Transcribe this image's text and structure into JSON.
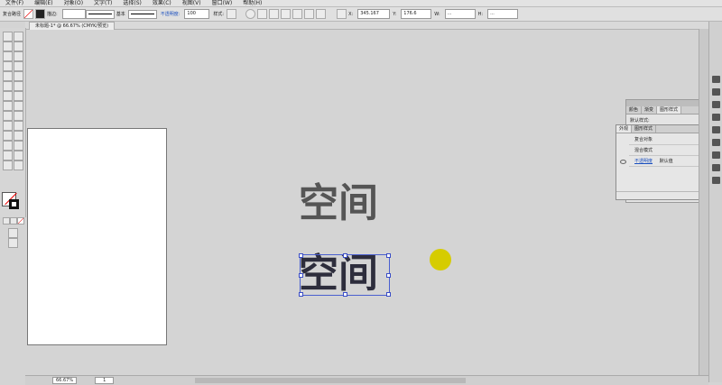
{
  "menubar": [
    "文件(F)",
    "编辑(E)",
    "对象(O)",
    "文字(T)",
    "选择(S)",
    "效果(C)",
    "视图(V)",
    "窗口(W)",
    "帮助(H)"
  ],
  "control_bar": {
    "selection_label": "复合路径",
    "stroke_label": "描边:",
    "stroke_style": "基本",
    "opacity_label": "不透明度:",
    "opacity_value": "100",
    "style_label": "样式:",
    "x_value": "345.167",
    "y_value": "176.6",
    "w_value": "...",
    "h_value": "..."
  },
  "document_tab": {
    "title": "未标题-1* @ 66.67% (CMYK/预览)"
  },
  "artwork": {
    "top_text": "空间",
    "selected_text": "空间",
    "dot_color": "#d6cc00"
  },
  "panel": {
    "tabs": [
      "颜色",
      "渐变",
      "图形样式"
    ],
    "inner_tabs": [
      "外观",
      "图形样式"
    ],
    "subtitle": "默认样式:",
    "rows": [
      {
        "label": "复合对象"
      },
      {
        "label": "混合模式"
      },
      {
        "label": "不透明度",
        "value": "默认值"
      }
    ]
  },
  "status_bar": {
    "zoom": "66.67%",
    "page": "1"
  }
}
